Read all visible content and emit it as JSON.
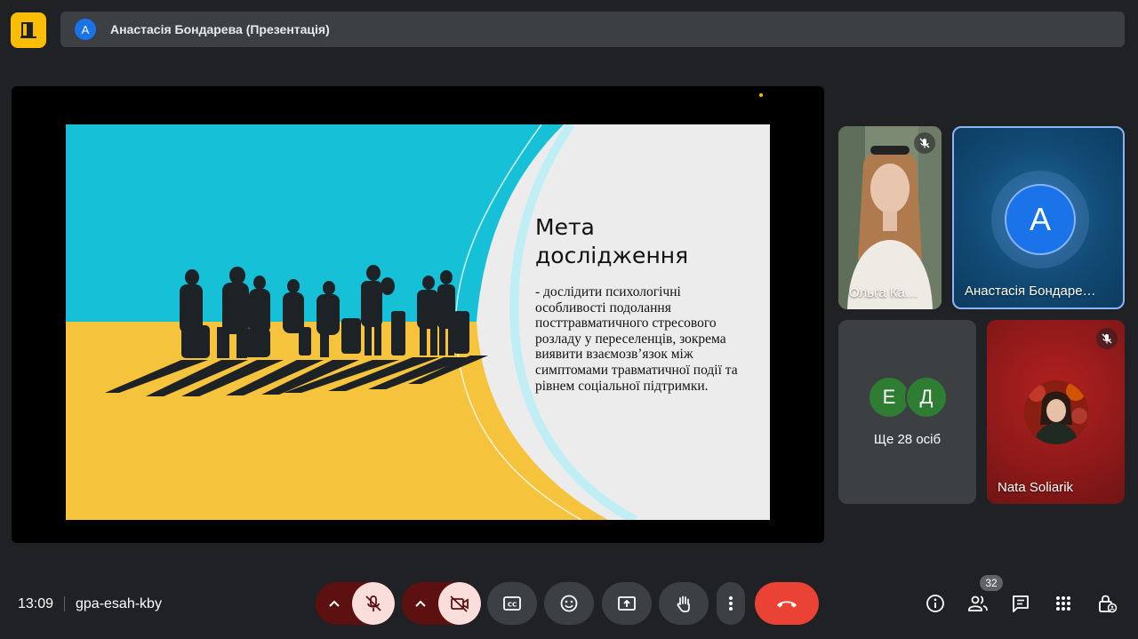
{
  "topbar": {
    "presenter_initial": "А",
    "presenter_label": "Анастасія Бондарева (Презентація)"
  },
  "slide": {
    "title": "Мета дослідження",
    "body": "- дослідити психологічні особливості подолання посттравматичного стресового розладу у переселенців, зокрема виявити взаємозв’язок між симптомами травматичної події та рівнем соціальної підтримки."
  },
  "participants": {
    "tile1": {
      "name": "Ольга Ка…",
      "muted": true
    },
    "tile2": {
      "name": "Анастасія Бондаре…",
      "initial": "А"
    },
    "tile3": {
      "initials": [
        "Е",
        "Д"
      ],
      "more": "Ще 28 осіб"
    },
    "tile4": {
      "name": "Nata Soliarik",
      "muted": true
    }
  },
  "bottombar": {
    "time": "13:09",
    "meeting_code": "gpa-esah-kby",
    "participants_count": "32"
  },
  "colors": {
    "accent_yellow": "#fbbc04",
    "hangup_red": "#ea4335",
    "mic_off_bg": "#f9dedc",
    "tile_blue": "#1a73e8"
  }
}
